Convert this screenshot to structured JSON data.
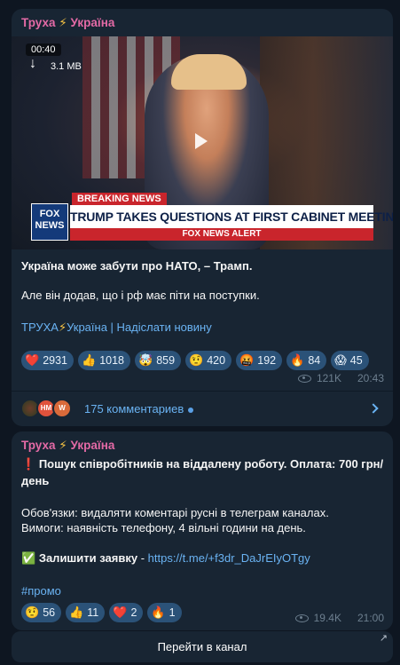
{
  "post1": {
    "channel_name": "Труха",
    "channel_bolt": "⚡",
    "channel_suffix": "Україна",
    "video": {
      "label": "00:40",
      "size": "3.1 MB",
      "breaking": "BREAKING NEWS",
      "headline": "TRUMP TAKES QUESTIONS AT FIRST CABINET MEETING",
      "alert": "FOX NEWS ALERT",
      "logo": "FOX NEWS"
    },
    "title": "Україна може забути про НАТО, – Трамп.",
    "body": "Але він додав, що і рф має піти на поступки.",
    "footer_channel": "ТРУХА",
    "footer_bolt": "⚡",
    "footer_ukr": "Україна",
    "footer_sep": " | ",
    "footer_link": "Надіслати новину",
    "reactions": [
      {
        "emoji": "❤️",
        "count": "2931",
        "icon": "heart-icon"
      },
      {
        "emoji": "👍",
        "count": "1018",
        "icon": "thumbs-up-icon"
      },
      {
        "emoji": "🤯",
        "count": "859",
        "icon": "mind-blown-icon"
      },
      {
        "emoji": "🤨",
        "count": "420",
        "icon": "raised-eyebrow-icon"
      },
      {
        "emoji": "🤬",
        "count": "192",
        "icon": "angry-face-icon"
      },
      {
        "emoji": "🔥",
        "count": "84",
        "icon": "fire-icon"
      },
      {
        "emoji": "😱",
        "count": "45",
        "icon": "scream-icon"
      }
    ],
    "views": "121K",
    "time": "20:43",
    "comments": {
      "avatar2": "HM",
      "avatar3": "W",
      "label": "175 комментариев"
    }
  },
  "post2": {
    "channel_name": "Труха",
    "channel_bolt": "⚡",
    "channel_suffix": "Україна",
    "headline_mark": "❗",
    "headline": "Пошук співробітників на віддалену роботу. Оплата: 700 грн/день",
    "line1": "Обов'язки: видаляти коментарі русні в телеграм каналах.",
    "line2": "Вимоги: наявність телефону, 4 вільні години на день.",
    "cta_mark": "✅",
    "cta_label": "Залишити заявку",
    "cta_sep": " - ",
    "cta_link": "https://t.me/+f3dr_DaJrEIyOTgy",
    "hashtag": "#промо",
    "reactions": [
      {
        "emoji": "🤨",
        "count": "56",
        "icon": "raised-eyebrow-icon"
      },
      {
        "emoji": "👍",
        "count": "11",
        "icon": "thumbs-up-icon"
      },
      {
        "emoji": "❤️",
        "count": "2",
        "icon": "heart-icon"
      },
      {
        "emoji": "🔥",
        "count": "1",
        "icon": "fire-icon"
      }
    ],
    "views": "19.4K",
    "time": "21:00"
  },
  "goto_channel": {
    "label": "Перейти в канал",
    "arrow": "↗"
  },
  "colors": {
    "background": "#0e1621",
    "bubble": "#182533",
    "channel_name": "#e46aa6",
    "link": "#6ab3f3",
    "reaction_pill": "#2b5278"
  }
}
